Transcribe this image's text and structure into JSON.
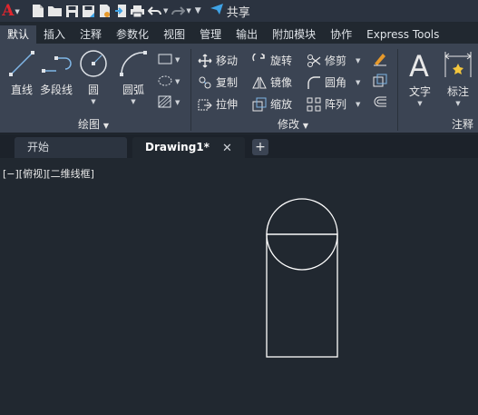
{
  "qat": {
    "logo": "A",
    "share_label": "共享"
  },
  "ribbon_tabs": [
    "默认",
    "插入",
    "注释",
    "参数化",
    "视图",
    "管理",
    "输出",
    "附加模块",
    "协作",
    "Express Tools"
  ],
  "draw_panel": {
    "line": "直线",
    "polyline": "多段线",
    "circle": "圆",
    "arc": "圆弧",
    "title": "绘图"
  },
  "modify_panel": {
    "move": "移动",
    "rotate": "旋转",
    "trim": "修剪",
    "copy": "复制",
    "mirror": "镜像",
    "fillet": "圆角",
    "stretch": "拉伸",
    "scale": "缩放",
    "array": "阵列",
    "title": "修改"
  },
  "annotation_panel": {
    "text": "文字",
    "dimension": "标注",
    "title": "注释"
  },
  "file_tabs": {
    "start": "开始",
    "drawing": "Drawing1*"
  },
  "viewport": {
    "label": "[−][俯视][二维线框]"
  },
  "colors": {
    "ribbon_bg": "#3b4453",
    "canvas_bg": "#212830",
    "logo_red": "#e0262e",
    "accent_blue": "#3fa3e6"
  }
}
